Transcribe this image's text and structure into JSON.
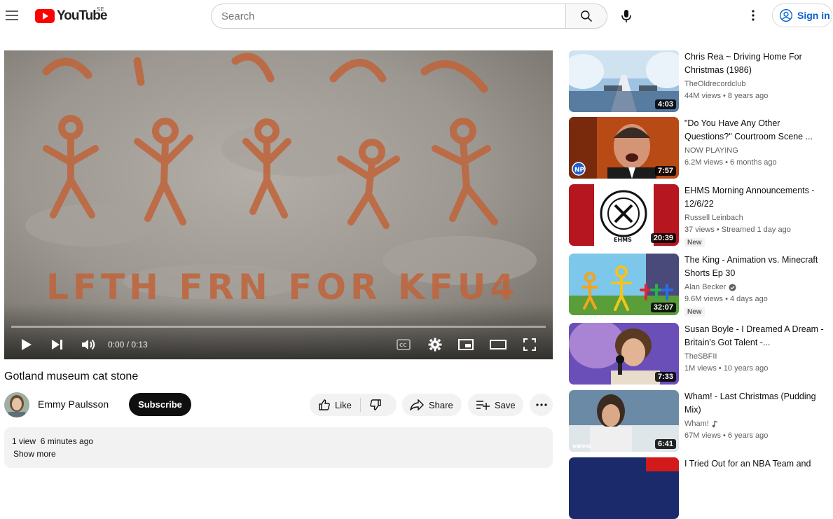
{
  "header": {
    "logo_text": "YouTube",
    "country_code": "SE",
    "search_placeholder": "Search",
    "signin_label": "Sign in"
  },
  "player": {
    "time": "0:00 / 0:13",
    "stone_inscription": "LFTH FRN FOR KFU4",
    "progress": 0
  },
  "video": {
    "title": "Gotland museum cat stone",
    "channel": "Emmy Paulsson",
    "subscribe_label": "Subscribe",
    "like_label": "Like",
    "share_label": "Share",
    "save_label": "Save",
    "views": "1 view",
    "posted": "6 minutes ago",
    "show_more": "Show more"
  },
  "recommendations": [
    {
      "title": "Chris Rea ~ Driving Home For Christmas (1986)",
      "channel": "TheOldrecordclub",
      "meta": "44M views • 8 years ago",
      "duration": "4:03",
      "badge": "",
      "verified": false,
      "music": false
    },
    {
      "title": "\"Do You Have Any Other Questions?\" Courtroom Scene ...",
      "channel": "NOW PLAYING",
      "meta": "6.2M views • 6 months ago",
      "duration": "7:57",
      "badge": "",
      "verified": false,
      "music": false,
      "thumb_logo": "NP"
    },
    {
      "title": "EHMS Morning Announcements - 12/6/22",
      "channel": "Russell Leinbach",
      "meta": "37 views • Streamed 1 day ago",
      "duration": "20:39",
      "badge": "New",
      "verified": false,
      "music": false,
      "thumb_text": "EHMS"
    },
    {
      "title": "The King - Animation vs. Minecraft Shorts Ep 30",
      "channel": "Alan Becker",
      "meta": "9.6M views • 4 days ago",
      "duration": "32:07",
      "badge": "New",
      "verified": true,
      "music": false
    },
    {
      "title": "Susan Boyle - I Dreamed A Dream - Britain's Got Talent -...",
      "channel": "TheSBFII",
      "meta": "1M views • 10 years ago",
      "duration": "7:33",
      "badge": "",
      "verified": false,
      "music": false
    },
    {
      "title": "Wham! - Last Christmas (Pudding Mix)",
      "channel": "Wham!",
      "meta": "67M views • 6 years ago",
      "duration": "6:41",
      "badge": "",
      "verified": false,
      "music": true,
      "thumb_logo": "vevo"
    },
    {
      "title": "I Tried Out for an NBA Team and",
      "channel": "",
      "meta": "",
      "duration": "",
      "badge": "",
      "verified": false,
      "music": false
    }
  ],
  "colors": {
    "brand_red": "#ff0000",
    "link_blue": "#065fd4",
    "chip_bg": "#f2f2f2",
    "ochre_paint": "#c0643a"
  }
}
